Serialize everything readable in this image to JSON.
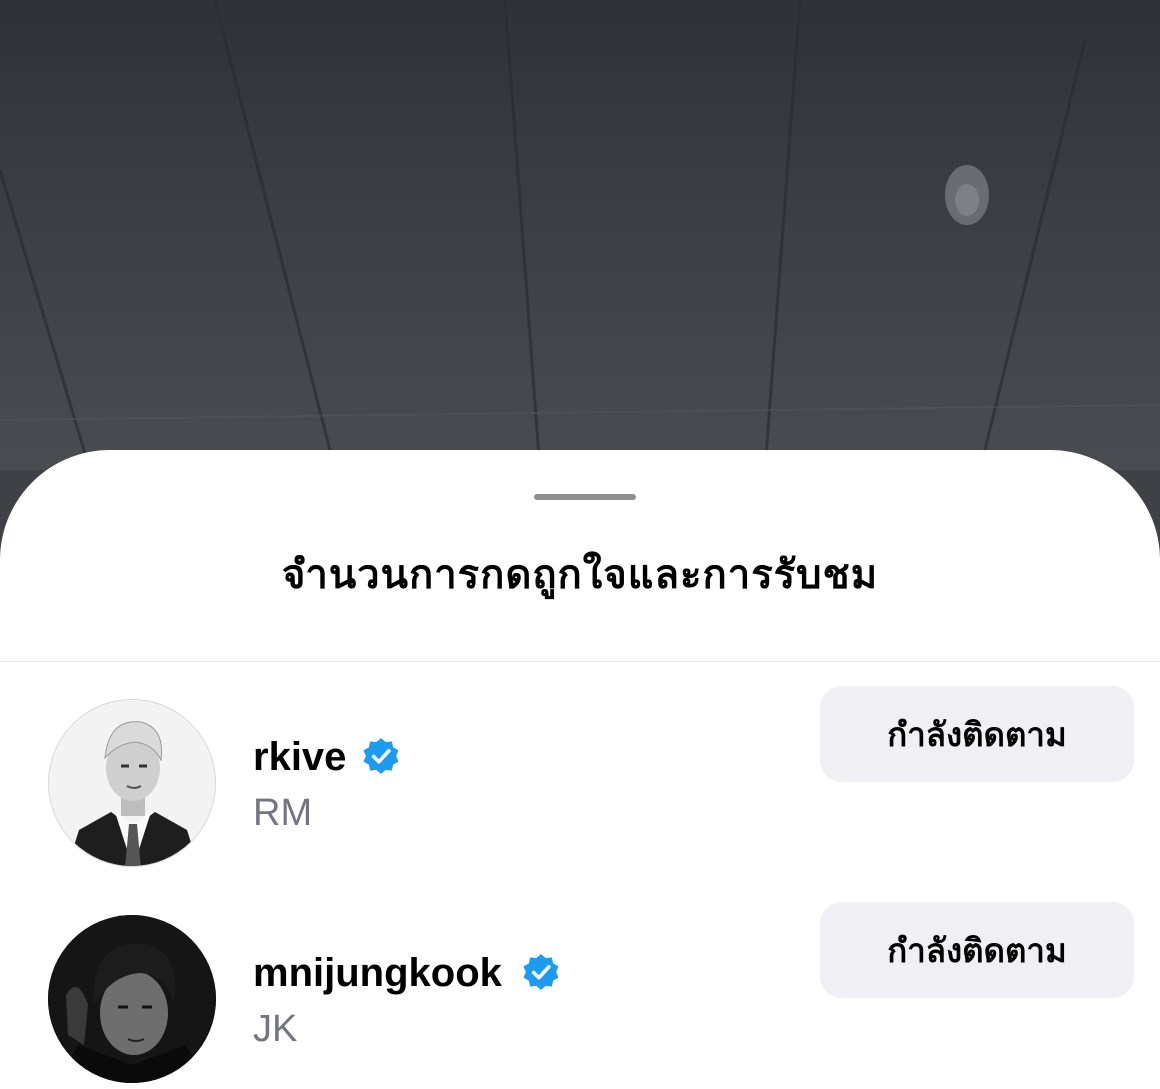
{
  "sheet": {
    "title": "จำนวนการกดถูกใจและการรับชม"
  },
  "accounts": [
    {
      "username": "rkive",
      "full_name": "RM",
      "verified": true,
      "follow_label": "กำลังติดตาม"
    },
    {
      "username": "mnijungkook",
      "full_name": "JK",
      "verified": true,
      "follow_label": "กำลังติดตาม"
    }
  ],
  "colors": {
    "verified_badge": "#1d9bf0",
    "follow_button_bg": "#efeff4",
    "secondary_text": "#737680"
  },
  "icons": {
    "verified": "verified-badge-icon"
  }
}
